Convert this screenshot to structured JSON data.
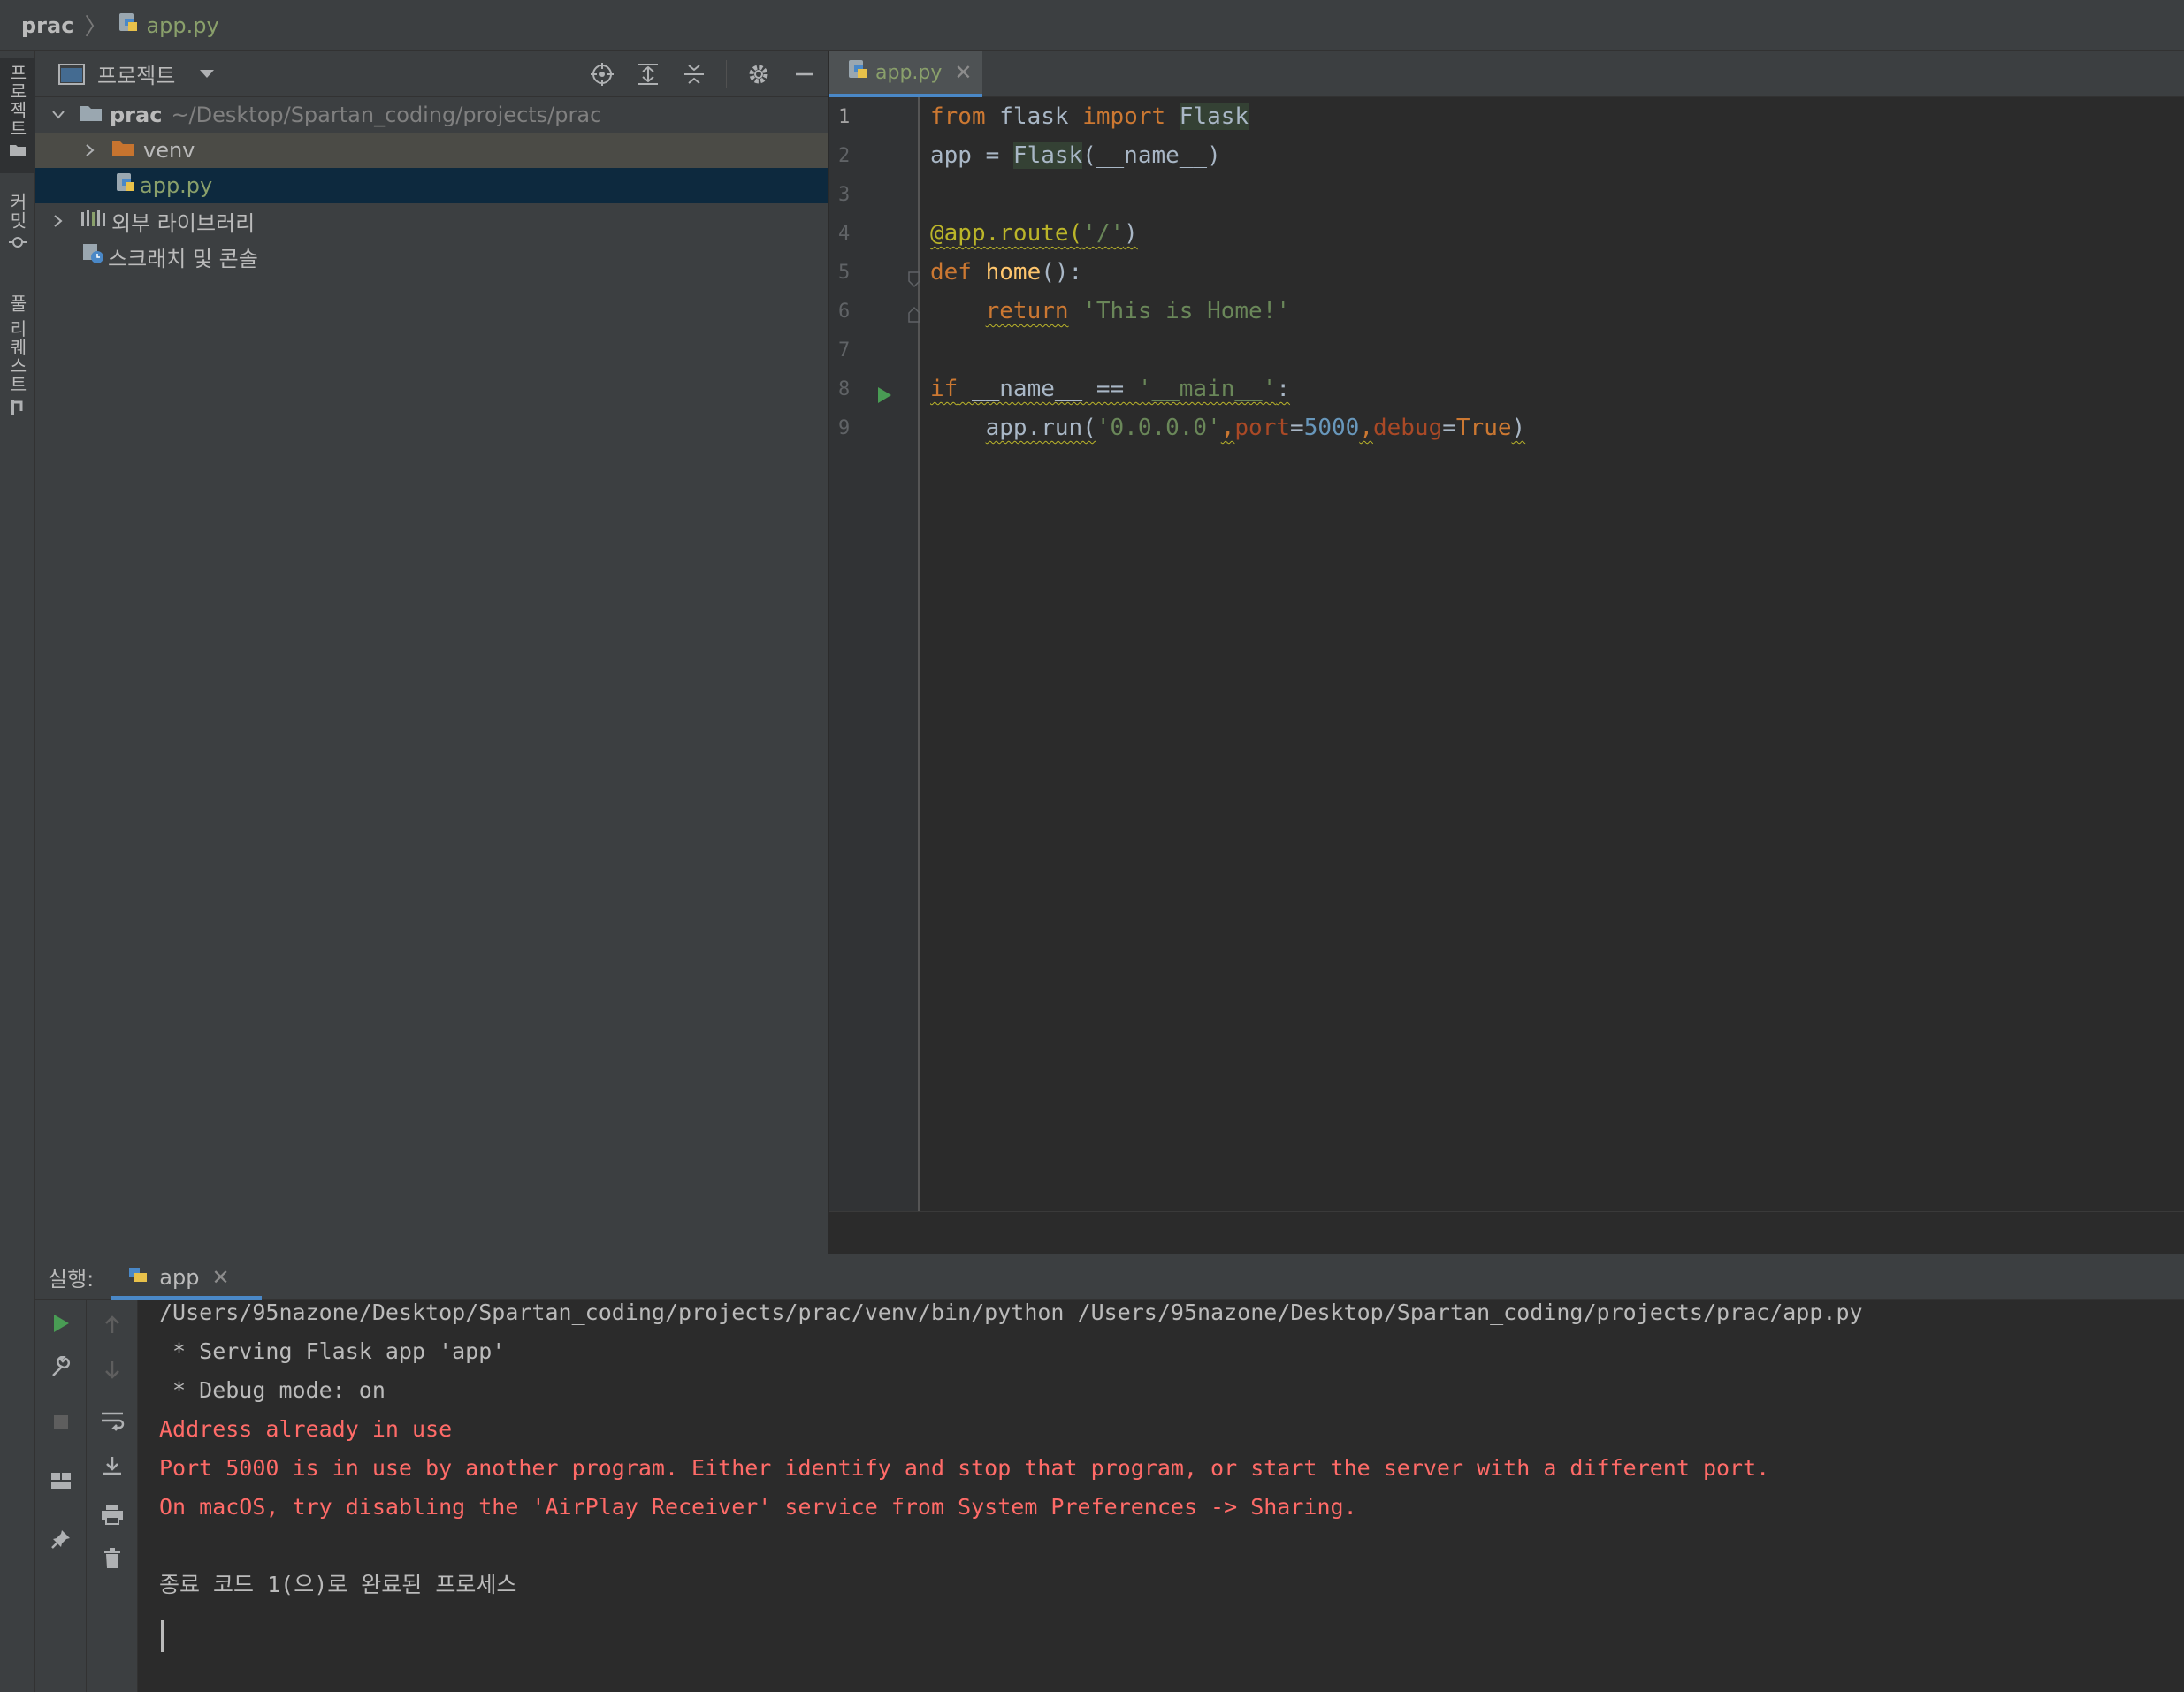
{
  "breadcrumb": {
    "project": "prac",
    "file": "app.py"
  },
  "left_stripe": {
    "project": "프로젝트",
    "commit": "커밋",
    "pull_requests": "풀 리퀘스트"
  },
  "project_panel": {
    "title": "프로젝트",
    "tree": {
      "root_name": "prac",
      "root_path": "~/Desktop/Spartan_coding/projects/prac",
      "venv": "venv",
      "file": "app.py",
      "external": "외부 라이브러리",
      "scratches": "스크래치 및 콘솔"
    }
  },
  "editor": {
    "tab": "app.py",
    "line_numbers": [
      "1",
      "2",
      "3",
      "4",
      "5",
      "6",
      "7",
      "8",
      "9"
    ],
    "code": {
      "l1_from": "from",
      "l1_mod": " flask ",
      "l1_import": "import",
      "l1_space": " ",
      "l1_cls": "Flask",
      "l2_a": "app = ",
      "l2_cls": "Flask",
      "l2_b": "(__name__)",
      "l4_deco": "@app.route(",
      "l4_str": "'/'",
      "l4_close": ")",
      "l5_def": "def",
      "l5_sp": " ",
      "l5_fn": "home",
      "l5_rest": "():",
      "l6_indent": "    ",
      "l6_ret": "return",
      "l6_sp": " ",
      "l6_str": "'This is Home!'",
      "l8_if": "if",
      "l8_a": " __name__ == ",
      "l8_str": "'__main__'",
      "l8_colon": ":",
      "l9_indent": "    ",
      "l9_a": "app.run(",
      "l9_str": "'0.0.0.0'",
      "l9_c1": ",",
      "l9_port": "port",
      "l9_eq1": "=",
      "l9_num": "5000",
      "l9_c2": ",",
      "l9_debug": "debug",
      "l9_eq2": "=",
      "l9_true": "True",
      "l9_close": ")"
    }
  },
  "run_panel": {
    "label": "실행:",
    "tab": "app",
    "lines": [
      "/Users/95nazone/Desktop/Spartan_coding/projects/prac/venv/bin/python /Users/95nazone/Desktop/Spartan_coding/projects/prac/app.py",
      " * Serving Flask app 'app'",
      " * Debug mode: on",
      "Address already in use",
      "Port 5000 is in use by another program. Either identify and stop that program, or start the server with a different port.",
      "On macOS, try disabling the 'AirPlay Receiver' service from System Preferences -> Sharing.",
      "종료 코드 1(으)로 완료된 프로세스"
    ]
  },
  "colors": {
    "accent": "#4a88c7",
    "error": "#ff6b68",
    "file_green": "#8aa06b",
    "keyword": "#cc7832",
    "string": "#6a8759"
  }
}
